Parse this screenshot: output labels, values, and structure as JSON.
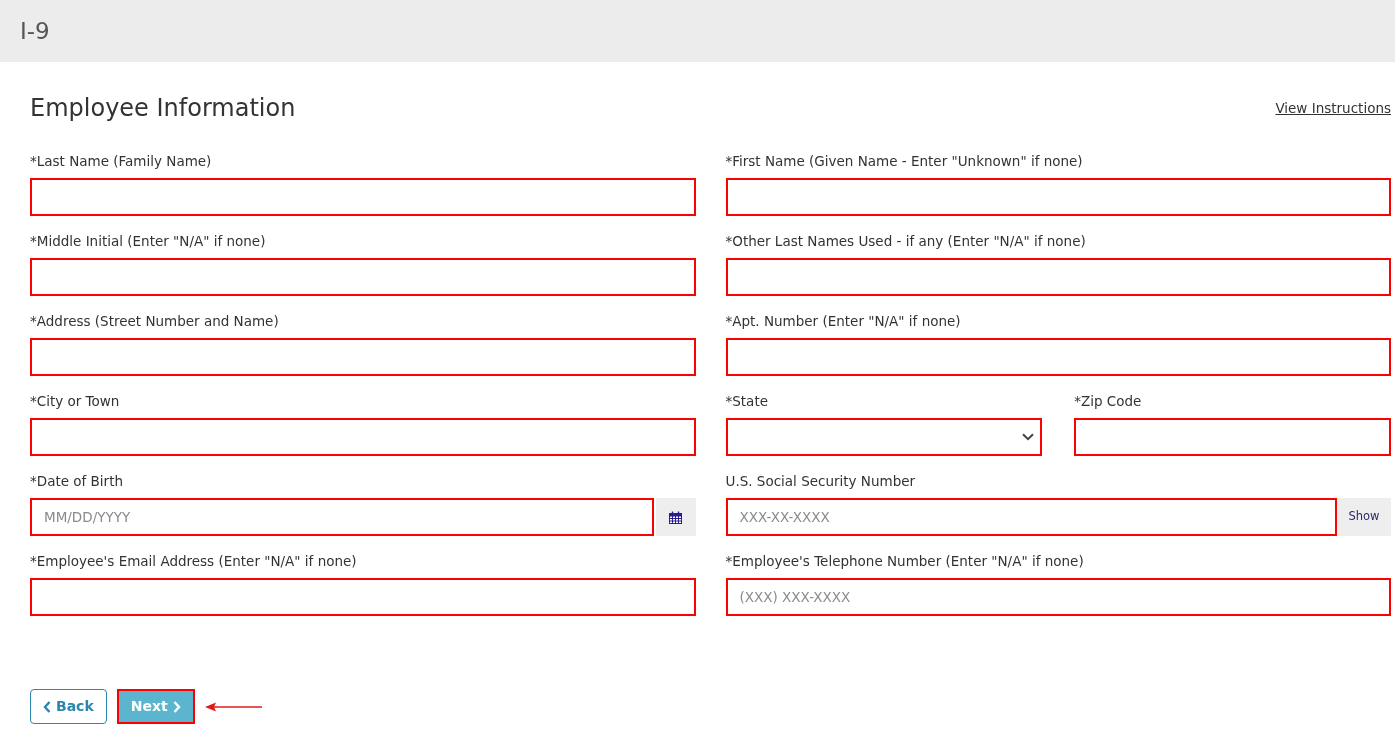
{
  "header": {
    "title": "I-9"
  },
  "section": {
    "title": "Employee Information",
    "link": "View Instructions"
  },
  "rows": [
    {
      "fields": [
        {
          "kind": "text",
          "label": "*Last Name (Family Name)",
          "highlighted": true
        },
        {
          "kind": "text",
          "label": "*First Name (Given Name - Enter \"Unknown\" if none)",
          "highlighted": true
        }
      ]
    },
    {
      "fields": [
        {
          "kind": "text",
          "label": "*Middle Initial (Enter \"N/A\" if none)",
          "highlighted": true
        },
        {
          "kind": "text",
          "label": "*Other Last Names Used - if any (Enter \"N/A\" if none)",
          "highlighted": true
        }
      ]
    },
    {
      "fields": [
        {
          "kind": "text",
          "label": "*Address (Street Number and Name)",
          "highlighted": true
        },
        {
          "kind": "text",
          "label": "*Apt. Number (Enter \"N/A\" if none)",
          "highlighted": true
        }
      ]
    },
    {
      "fields": [
        {
          "kind": "text",
          "label": "*City or Town",
          "highlighted": true
        },
        {
          "kind": "select",
          "label": "*State",
          "highlighted": true
        },
        {
          "kind": "text",
          "label": "*Zip Code",
          "highlighted": true
        }
      ]
    },
    {
      "fields": [
        {
          "kind": "date",
          "label": "*Date of Birth",
          "placeholder": "MM/DD/YYYY",
          "highlighted": true
        },
        {
          "kind": "masked",
          "label": "U.S. Social Security Number",
          "placeholder": "XXX-XX-XXXX",
          "toggle": "Show",
          "highlighted": true
        }
      ]
    },
    {
      "fields": [
        {
          "kind": "text",
          "label": "*Employee's Email Address (Enter \"N/A\" if none)",
          "highlighted": true
        },
        {
          "kind": "text",
          "label": "*Employee's Telephone Number (Enter \"N/A\" if none)",
          "placeholder": "(XXX) XXX-XXXX",
          "highlighted": true
        }
      ]
    }
  ],
  "buttons": [
    {
      "kind": "back",
      "label": "Back",
      "highlighted": false
    },
    {
      "kind": "next",
      "label": "Next",
      "highlighted": true,
      "pointer_arrow": true
    }
  ]
}
